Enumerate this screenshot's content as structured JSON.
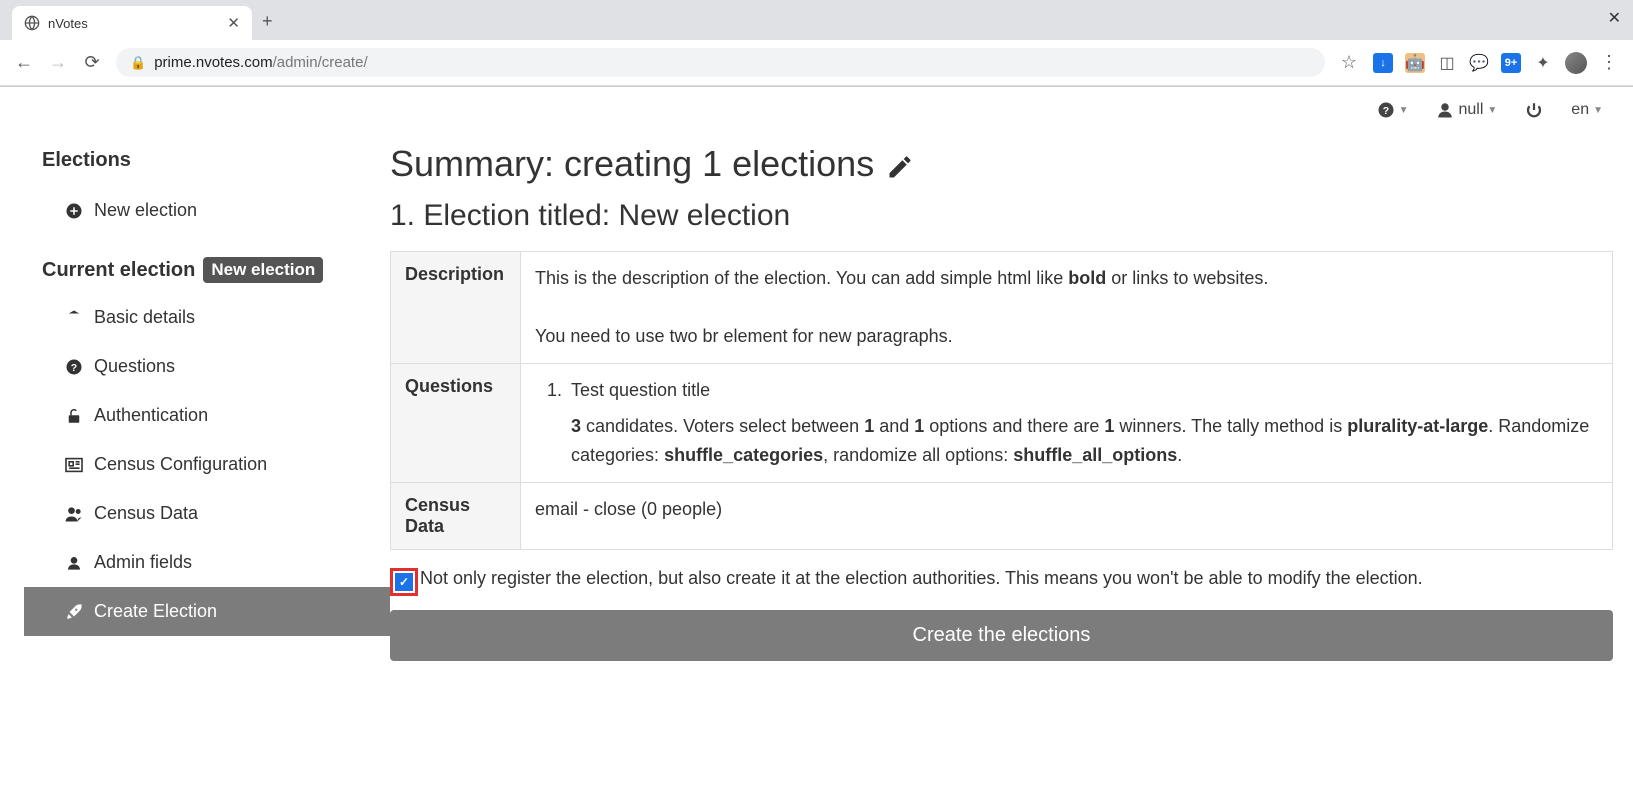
{
  "browser": {
    "tab_title": "nVotes",
    "url_host": "prime.nvotes.com",
    "url_path": "/admin/create/"
  },
  "topbar": {
    "user_label": "null",
    "lang_label": "en"
  },
  "sidebar": {
    "heading_elections": "Elections",
    "new_election": "New election",
    "heading_current": "Current election",
    "current_badge": "New election",
    "items": {
      "basic": "Basic details",
      "questions": "Questions",
      "auth": "Authentication",
      "census_config": "Census Configuration",
      "census_data": "Census Data",
      "admin_fields": "Admin fields",
      "create": "Create Election"
    }
  },
  "main": {
    "summary_title": "Summary: creating 1 elections",
    "election_heading": "1. Election titled: New election",
    "labels": {
      "description": "Description",
      "questions": "Questions",
      "census": "Census Data"
    },
    "description": {
      "line1_pre": "This is the description of the election. You can add simple html like ",
      "bold_word": "bold",
      "line1_post": " or links to websites.",
      "line2": "You need to use two br element for new paragraphs."
    },
    "question": {
      "title": "Test question title",
      "candidates_num": "3",
      "text_a": " candidates. Voters select between ",
      "min": "1",
      "text_b": " and ",
      "max": "1",
      "text_c": " options and there are ",
      "winners": "1",
      "text_d": " winners. The tally method is ",
      "method": "plurality-at-large",
      "text_e": ". Randomize categories: ",
      "shuffle_cat": "shuffle_categories",
      "text_f": ", randomize all options: ",
      "shuffle_opt": "shuffle_all_options",
      "text_g": "."
    },
    "census_value": "email - close (0 people)",
    "checkbox_label": "Not only register the election, but also create it at the election authorities. This means you won't be able to modify the election.",
    "create_button": "Create the elections"
  }
}
